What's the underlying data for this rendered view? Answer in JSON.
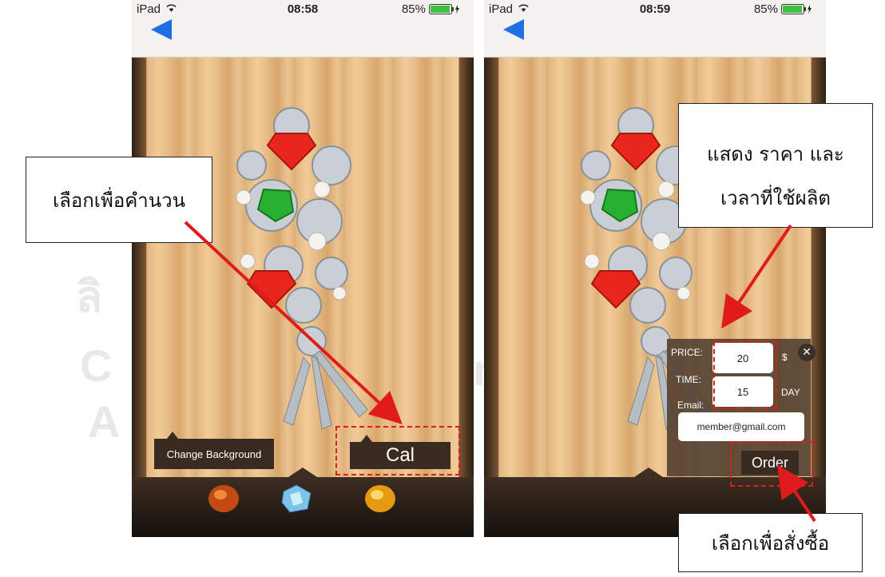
{
  "watermark": {
    "line1": "ลิ",
    "line2": "C",
    "line3": "A",
    "line4": "r"
  },
  "left_device": {
    "status": {
      "carrier": "iPad",
      "time": "08:58",
      "battery": "85%"
    },
    "change_background_label": "Change Background",
    "cal_label": "Cal"
  },
  "right_device": {
    "status": {
      "carrier": "iPad",
      "time": "08:59",
      "battery": "85%"
    },
    "order_panel": {
      "price_label": "PRICE:",
      "price_value": "20",
      "price_unit": "$",
      "time_label": "TIME:",
      "time_value": "15",
      "time_unit": "DAY",
      "email_label": "Email:",
      "email_value": "member@gmail.com",
      "order_label": "Order"
    }
  },
  "annotations": {
    "select_to_calculate": "เลือกเพื่อคำนวน",
    "show_price_line1": "แสดง ราคา และ",
    "show_price_line2": "เวลาที่ใช้ผลิต",
    "select_to_order": "เลือกเพื่อสั่งซื้อ"
  },
  "colors": {
    "annotation_red": "#e01b1b",
    "back_arrow_blue": "#1f6fe0",
    "panel_brown": "#3a2b20"
  },
  "gems": [
    "orange-garnet",
    "blue-topaz",
    "yellow-citrine"
  ]
}
